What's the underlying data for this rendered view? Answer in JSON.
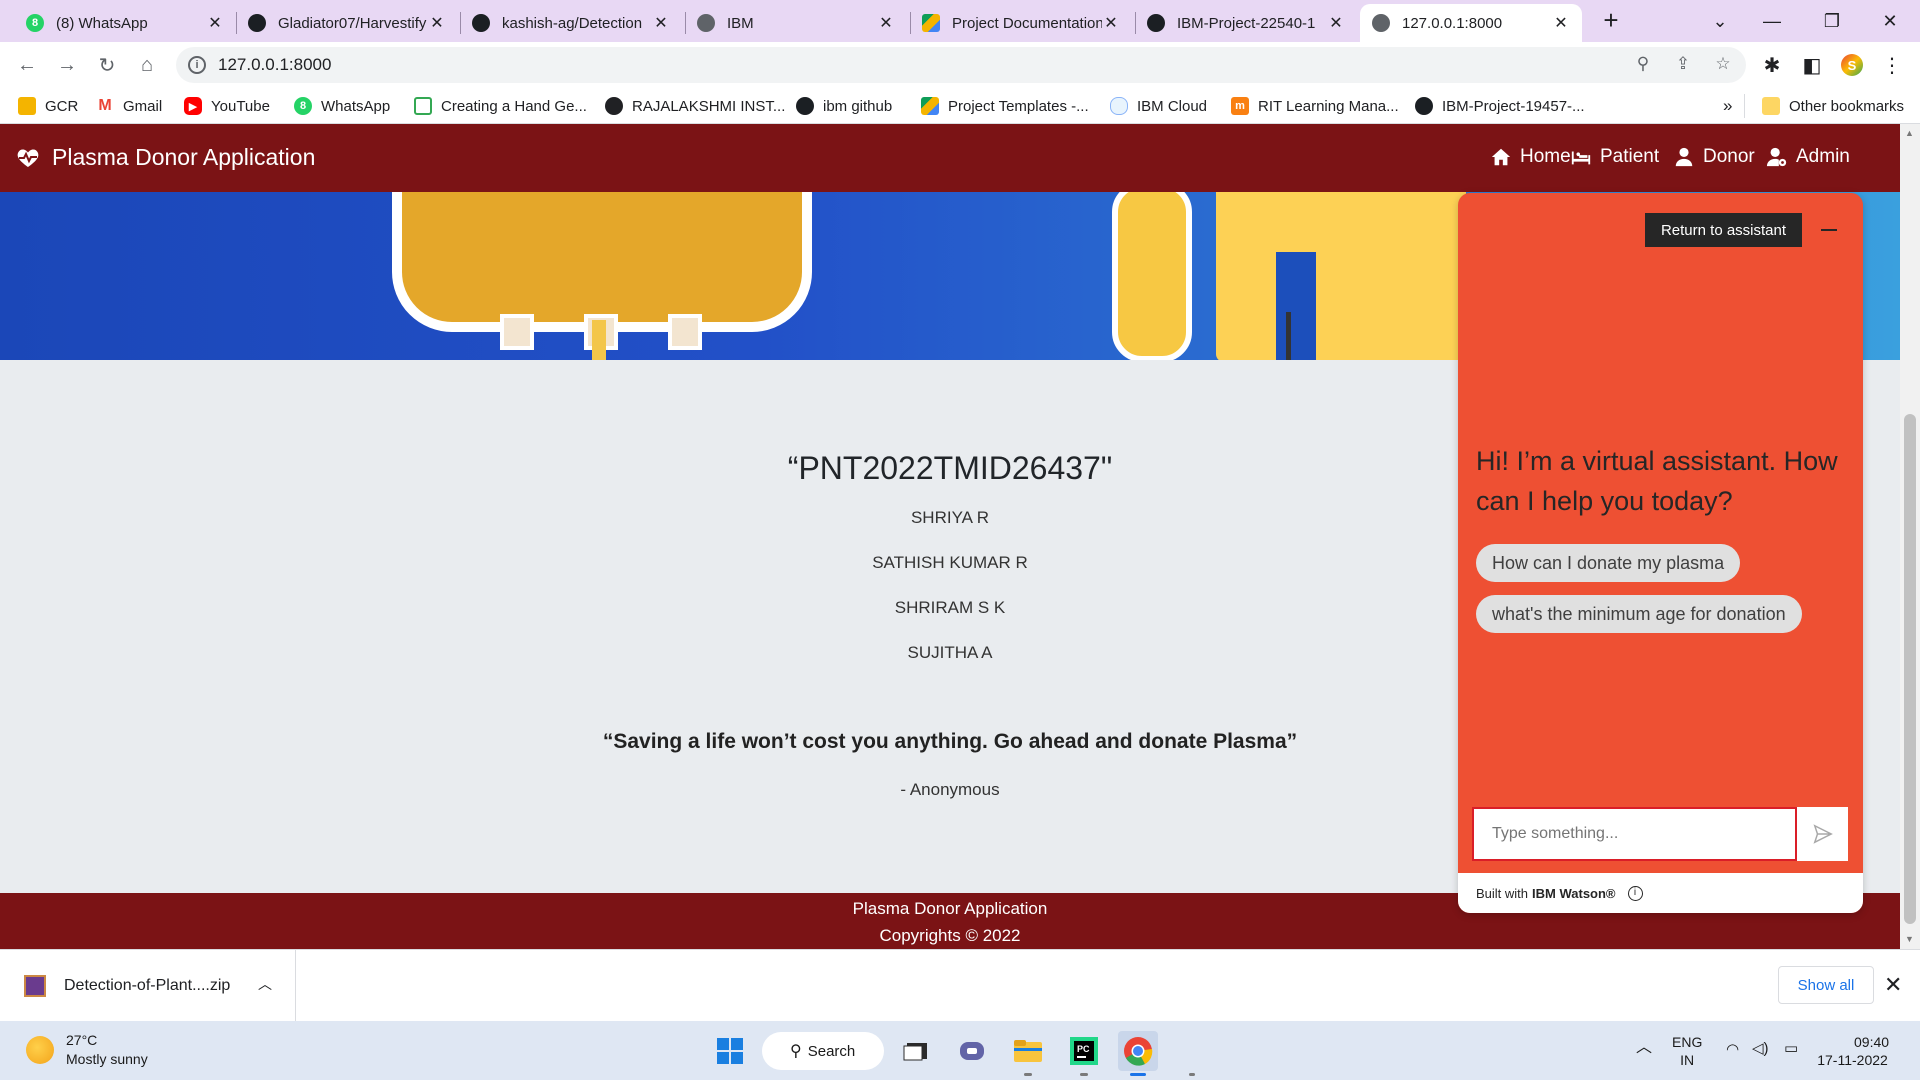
{
  "browser": {
    "tabs": [
      {
        "title": "(8) WhatsApp",
        "favicon": "whatsapp-icon",
        "badge": "8"
      },
      {
        "title": "Gladiator07/Harvestify",
        "favicon": "github-icon"
      },
      {
        "title": "kashish-ag/Detection",
        "favicon": "github-icon"
      },
      {
        "title": "IBM",
        "favicon": "globe-icon"
      },
      {
        "title": "Project Documentation",
        "favicon": "google-drive-icon"
      },
      {
        "title": "IBM-Project-22540-1",
        "favicon": "github-icon"
      },
      {
        "title": "127.0.0.1:8000",
        "favicon": "globe-icon",
        "active": true
      }
    ],
    "new_tab": "+",
    "url": "127.0.0.1:8000",
    "bookmarks": [
      {
        "label": "GCR",
        "icon": "gcr-icon"
      },
      {
        "label": "Gmail",
        "icon": "gmail-icon"
      },
      {
        "label": "YouTube",
        "icon": "youtube-icon"
      },
      {
        "label": "WhatsApp",
        "icon": "whatsapp-icon"
      },
      {
        "label": "Creating a Hand Ge...",
        "icon": "bookmark-doc-icon"
      },
      {
        "label": "RAJALAKSHMI INST...",
        "icon": "compass-icon"
      },
      {
        "label": "ibm github",
        "icon": "github-icon"
      },
      {
        "label": "Project Templates -...",
        "icon": "google-drive-icon"
      },
      {
        "label": "IBM Cloud",
        "icon": "cloud-icon"
      },
      {
        "label": "RIT Learning Mana...",
        "icon": "moodle-icon"
      },
      {
        "label": "IBM-Project-19457-...",
        "icon": "github-icon"
      }
    ],
    "bookmarks_overflow": "»",
    "other_bookmarks": "Other bookmarks"
  },
  "app": {
    "brand": "Plasma Donor Application",
    "nav": [
      {
        "label": "Home",
        "icon": "home-icon"
      },
      {
        "label": "Patient",
        "icon": "bed-icon"
      },
      {
        "label": "Donor",
        "icon": "user-icon"
      },
      {
        "label": "Admin",
        "icon": "user-cog-icon"
      }
    ],
    "team_id": "“PNT2022TMID26437\"",
    "members": [
      "SHRIYA R",
      "SATHISH KUMAR R",
      "SHRIRAM S K",
      "SUJITHA A"
    ],
    "quote": "“Saving a life won’t cost you anything. Go ahead and donate Plasma”",
    "quote_author": "- Anonymous",
    "footer_line1": "Plasma Donor Application",
    "footer_line2": "Copyrights © 2022"
  },
  "chat": {
    "return_button": "Return to assistant",
    "greeting": "Hi! I’m a virtual assistant. How can I help you today?",
    "suggestions": [
      "How can I donate my plasma",
      "what's the minimum age for donation"
    ],
    "input_placeholder": "Type something...",
    "footer_prefix": "Built with",
    "footer_brand": "IBM Watson®",
    "colors": {
      "background": "#ee5033",
      "button": "#262626"
    }
  },
  "downloads": {
    "file": "Detection-of-Plant....zip",
    "show_all": "Show all"
  },
  "taskbar": {
    "temperature": "27°C",
    "weather": "Mostly sunny",
    "search_label": "Search",
    "lang_top": "ENG",
    "lang_bottom": "IN",
    "time": "09:40",
    "date": "17-11-2022"
  },
  "colors": {
    "navbar": "#7b1315",
    "page_bg": "#e9ecef"
  }
}
